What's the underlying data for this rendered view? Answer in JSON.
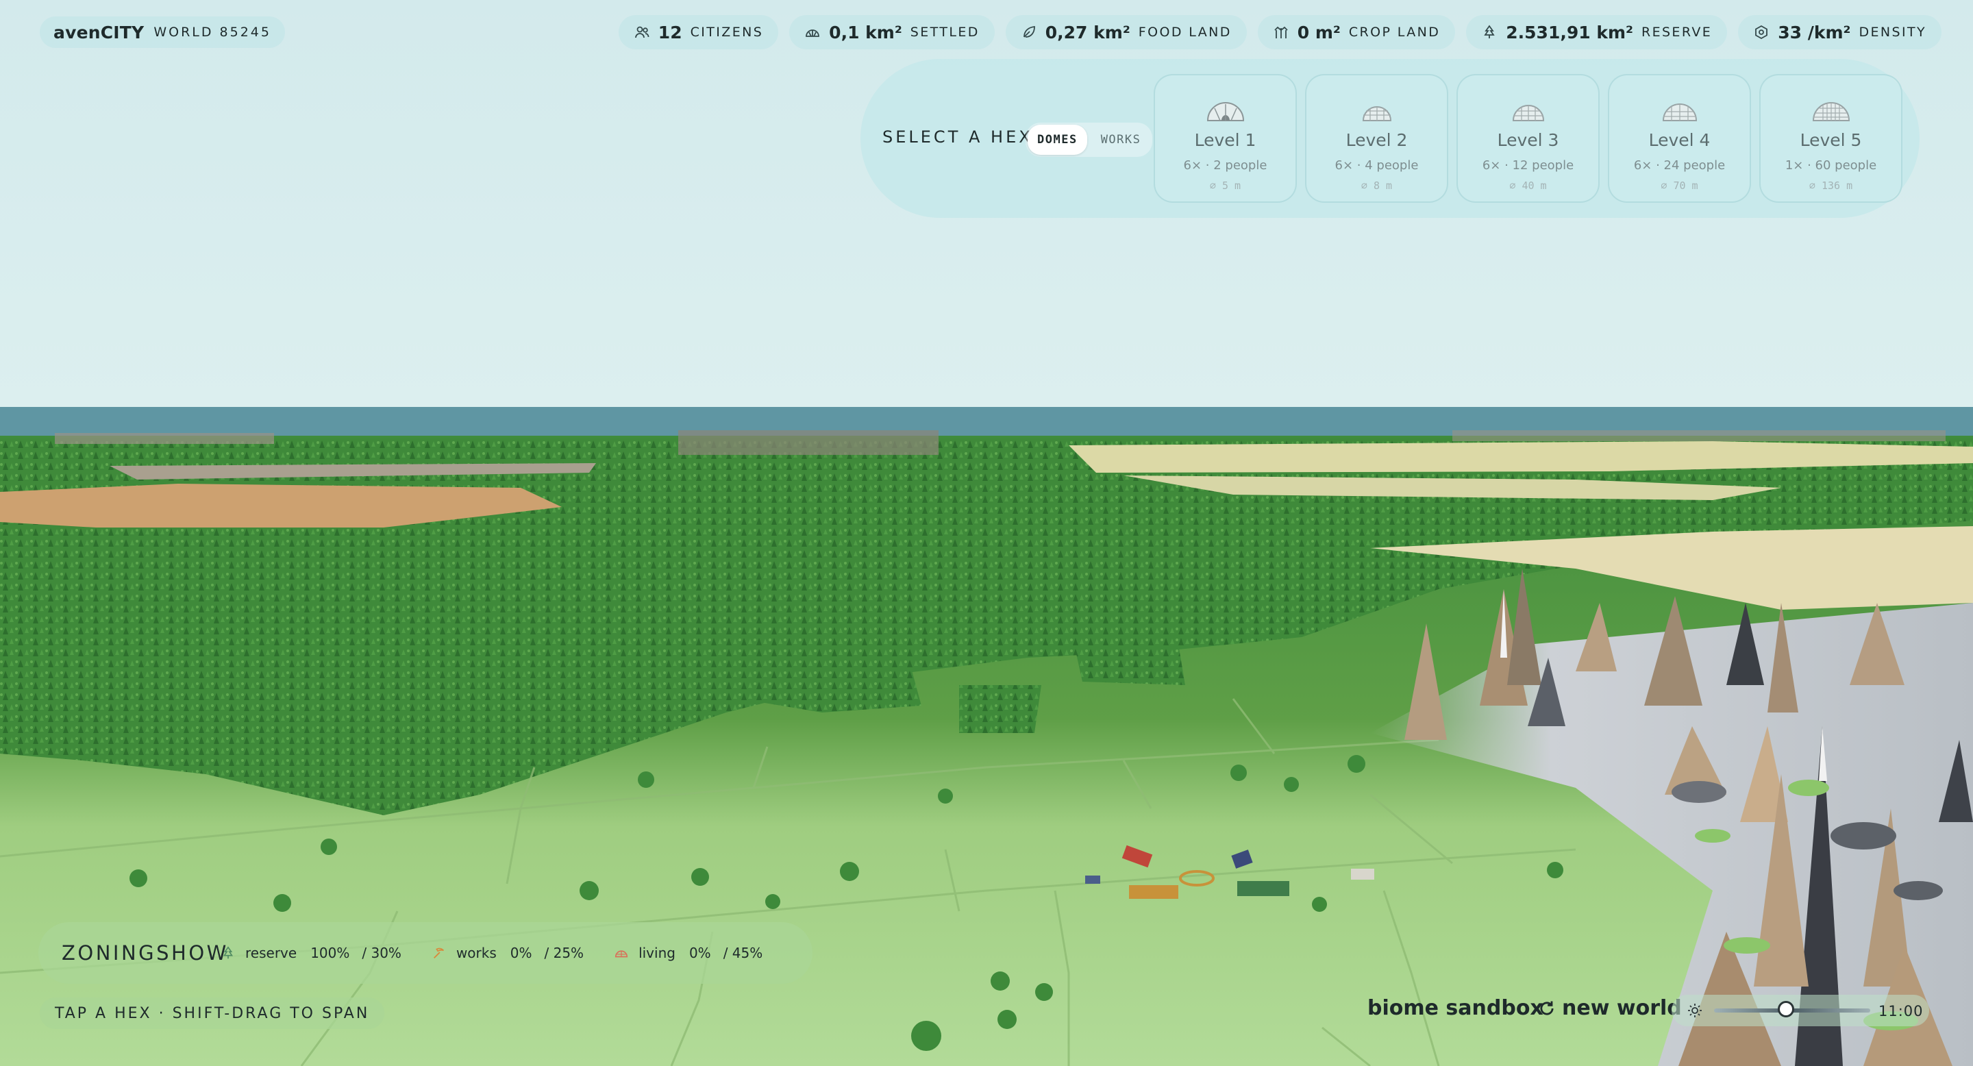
{
  "brand": {
    "name": "avenCITY",
    "world": "WORLD 85245"
  },
  "stats": [
    {
      "icon": "citizens-icon",
      "value": "12",
      "label": "CITIZENS"
    },
    {
      "icon": "dome-icon",
      "value": "0,1 km²",
      "label": "SETTLED"
    },
    {
      "icon": "leaf-icon",
      "value": "0,27 km²",
      "label": "FOOD LAND"
    },
    {
      "icon": "crop-icon",
      "value": "0 m²",
      "label": "CROP LAND"
    },
    {
      "icon": "tree-icon",
      "value": "2.531,91 km²",
      "label": "RESERVE"
    },
    {
      "icon": "hexagon-icon",
      "value": "33 /km²",
      "label": "DENSITY"
    }
  ],
  "picker": {
    "title": "SELECT A HEX",
    "tabs": [
      {
        "label": "DOMES",
        "active": true
      },
      {
        "label": "WORKS",
        "active": false
      }
    ],
    "levels": [
      {
        "label": "Level 1",
        "people": "6× · 2 people",
        "diameter": "⌀ 5 m"
      },
      {
        "label": "Level 2",
        "people": "6× · 4 people",
        "diameter": "⌀ 8 m"
      },
      {
        "label": "Level 3",
        "people": "6× · 12 people",
        "diameter": "⌀ 40 m"
      },
      {
        "label": "Level 4",
        "people": "6× · 24 people",
        "diameter": "⌀ 70 m"
      },
      {
        "label": "Level 5",
        "people": "1× · 60 people",
        "diameter": "⌀ 136 m"
      }
    ]
  },
  "zoning": {
    "title": "ZONINGSHOW",
    "items": [
      {
        "icon": "tree-icon",
        "name": "reserve",
        "percent": "100%",
        "target": "/ 30%",
        "color": "#4f8a62"
      },
      {
        "icon": "pickaxe-icon",
        "name": "works",
        "percent": "0%",
        "target": "/ 25%",
        "color": "#d98a3c"
      },
      {
        "icon": "dome-icon",
        "name": "living",
        "percent": "0%",
        "target": "/ 45%",
        "color": "#d9705a"
      }
    ]
  },
  "hint": "TAP A HEX · SHIFT-DRAG TO SPAN",
  "footer": {
    "biome": "biome sandbox",
    "new_world": "new world"
  },
  "time": {
    "clock": "11:00",
    "day_fraction": 0.46
  },
  "colors": {
    "sky": "#d6ebec",
    "sea": "#5f96a3",
    "grass": "#a9d48d",
    "forest": "#2f7a37",
    "rock": "#b59a7c"
  }
}
